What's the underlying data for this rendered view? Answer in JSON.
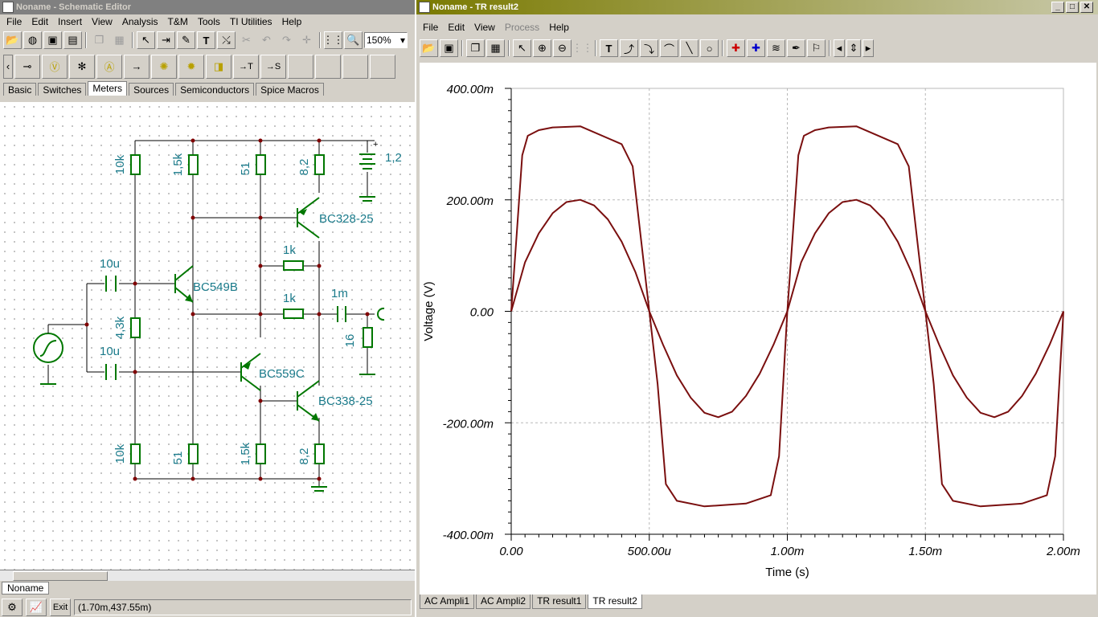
{
  "schematic_window": {
    "title": "Noname - Schematic Editor",
    "menu": [
      "File",
      "Edit",
      "Insert",
      "View",
      "Analysis",
      "T&M",
      "Tools",
      "TI Utilities",
      "Help"
    ],
    "zoom": "150%",
    "component_tabs": [
      "Basic",
      "Switches",
      "Meters",
      "Sources",
      "Semiconductors",
      "Spice Macros"
    ],
    "selected_tab": "Meters",
    "sheet_tab": "Noname",
    "exit_label": "Exit",
    "coordinates": "(1.70m,437.55m)"
  },
  "schematic": {
    "labels": {
      "r1": "10k",
      "r2": "1,5k",
      "r3": "51",
      "r4": "8,2",
      "battery": "1,2",
      "q1": "BC328-25",
      "r5": "1k",
      "c1": "10u",
      "q2": "BC549B",
      "r6": "1k",
      "c3": "1m",
      "r7": "4,3k",
      "r8": "16",
      "c2": "10u",
      "q3": "BC559C",
      "q4": "BC338-25",
      "r9": "10k",
      "r10": "51",
      "r11": "1,5k",
      "r12": "8,2",
      "plus": "+"
    }
  },
  "result_window": {
    "title": "Noname - TR result2",
    "menu": [
      "File",
      "Edit",
      "View",
      "Process",
      "Help"
    ],
    "disabled_menu": [
      "Process"
    ],
    "bottom_tabs": [
      "AC Ampli1",
      "AC Ampli2",
      "TR result1",
      "TR result2"
    ],
    "selected_tab": "TR result2"
  },
  "chart_data": {
    "type": "line",
    "xlabel": "Time (s)",
    "ylabel": "Voltage (V)",
    "xlim": [
      0,
      0.002
    ],
    "ylim": [
      -0.4,
      0.4
    ],
    "x_tick_labels": [
      "0.00",
      "500.00u",
      "1.00m",
      "1.50m",
      "2.00m"
    ],
    "y_tick_labels": [
      "400.00m",
      "200.00m",
      "0.00",
      "-200.00m",
      "-400.00m"
    ],
    "grid": true,
    "line_color": "#7a0f0f",
    "series": [
      {
        "x": [
          0,
          5e-05,
          0.0001,
          0.00015,
          0.0002,
          0.00025,
          0.0003,
          0.00035,
          0.0004,
          0.00045,
          0.0005,
          0.00055,
          0.0006,
          0.00065,
          0.0007,
          0.00075,
          0.0008,
          0.00085,
          0.0009,
          0.00095,
          0.001,
          0.00105,
          0.0011,
          0.00115,
          0.0012,
          0.00125,
          0.0013,
          0.00135,
          0.0014,
          0.00145,
          0.0015,
          0.00155,
          0.0016,
          0.00165,
          0.0017,
          0.00175,
          0.0018,
          0.00185,
          0.0019,
          0.00195,
          0.002
        ],
        "y": [
          0,
          0.088,
          0.14,
          0.176,
          0.196,
          0.2,
          0.19,
          0.165,
          0.125,
          0.07,
          0,
          -0.06,
          -0.115,
          -0.155,
          -0.182,
          -0.19,
          -0.18,
          -0.152,
          -0.112,
          -0.06,
          0,
          0.088,
          0.14,
          0.176,
          0.196,
          0.2,
          0.19,
          0.165,
          0.125,
          0.07,
          0,
          -0.06,
          -0.115,
          -0.155,
          -0.182,
          -0.19,
          -0.18,
          -0.152,
          -0.112,
          -0.06,
          0
        ]
      },
      {
        "x": [
          0,
          2e-05,
          4e-05,
          6e-05,
          0.0001,
          0.00015,
          0.00025,
          0.0004,
          0.00044,
          0.00047,
          0.0005,
          0.00053,
          0.00056,
          0.0006,
          0.0007,
          0.00085,
          0.00094,
          0.00097,
          0.001,
          0.00102,
          0.00104,
          0.00106,
          0.0011,
          0.00115,
          0.00125,
          0.0014,
          0.00144,
          0.00147,
          0.0015,
          0.00153,
          0.00156,
          0.0016,
          0.0017,
          0.00185,
          0.00194,
          0.00197,
          0.002
        ],
        "y": [
          0,
          0.14,
          0.28,
          0.315,
          0.325,
          0.33,
          0.332,
          0.3,
          0.26,
          0.13,
          0,
          -0.13,
          -0.31,
          -0.34,
          -0.35,
          -0.345,
          -0.33,
          -0.26,
          0,
          0.14,
          0.28,
          0.315,
          0.325,
          0.33,
          0.332,
          0.3,
          0.26,
          0.13,
          0,
          -0.13,
          -0.31,
          -0.34,
          -0.35,
          -0.345,
          -0.33,
          -0.26,
          0
        ]
      }
    ]
  }
}
